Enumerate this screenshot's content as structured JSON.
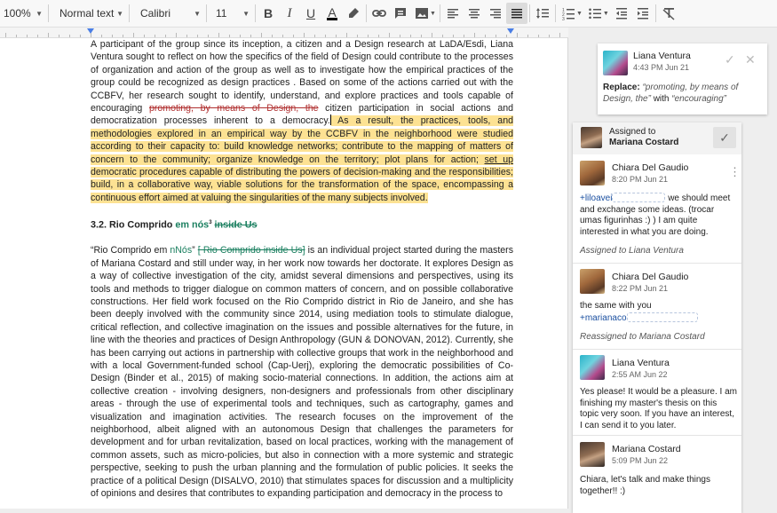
{
  "toolbar": {
    "zoom": "100%",
    "style": "Normal text",
    "font": "Calibri",
    "size": "11"
  },
  "document": {
    "para1_a": "A participant of the group since its inception, a citizen and a Design research at LaDA/Esdi, Liana Ventura sought to reflect on how the specifics of the field of Design could contribute to the processes of organization and action of the group as well as to investigate how the empirical practices of the group could be recognized as design practices . Based on some of the actions carried out with the CCBFV, her research sought to identify, understand, and explore practices and tools capable of encouraging ",
    "para1_strike": "promoting, by means of Design, the",
    "para1_b": " citizen participation in social actions and democratization processes inherent to a democracy.",
    "para1_hl_a": " As a result, the practices, tools, and methodologies explored in an empirical way by the CCBFV in the neighborhood were studied according to their capacity to: build knowledge networks; contribute to the mapping of matters of concern to the community; organize knowledge on the territory; plot plans for action; ",
    "para1_hl_u": "set up",
    "para1_hl_b": " democratic procedures capable of distributing the powers of decision-making and the responsibilities; build, in a collaborative way, viable solutions for the transformation of the space, encompassing a continuous effort aimed at valuing the singularities of the many subjects involved.",
    "heading_a": "3.2. Rio Comprido ",
    "heading_green": "em nós",
    "heading_sup": "3",
    "heading_strike": "inside Us",
    "para2_a": "“Rio Comprido em ",
    "para2_green": "nNós",
    "para2_q": "” ",
    "para2_strike": "[ Rio Comprido inside Us]",
    "para2_b": " is an individual project started during the masters of Mariana Costard and still under way, in her work now towards her doctorate. It explores Design as a way of collective investigation of the city, amidst several dimensions and perspectives, using its tools and methods to trigger dialogue on common matters of concern, and on possible collaborative constructions. Her field work focused on the Rio Comprido district in Rio de Janeiro, and she has been deeply involved with the community since 2014, using mediation tools to stimulate dialogue, critical reflection, and collective imagination on the issues and possible alternatives for the future, in line with the theories and practices of Design Anthropology (GUN & DONOVAN, 2012). Currently, she has been carrying out actions in partnership with collective groups that work in the neighborhood and with a local Government-funded school (Cap-Uerj), exploring the democratic possibilities of Co-Design (Binder et al., 2015) of making socio-material connections. In addition, the actions aim at collective creation - involving designers, non-designers and professionals from other disciplinary areas - through the use of experimental tools and techniques, such as cartography, games and visualization and imagination activities. The research focuses on the improvement of the neighborhood, albeit aligned with an autonomous Design that challenges the parameters for development and for urban revitalization, based on local practices, working with the management of common assets, such as micro-policies, but also in connection with a more systemic and strategic perspective, seeking to push the urban planning and the formulation of public policies. It seeks the practice of a political Design (DISALVO, 2010) that stimulates spaces for discussion and a multiplicity of opinions and desires that contributes to expanding participation and democracy in the process to"
  },
  "suggestion": {
    "author": "Liana Ventura",
    "time": "4:43 PM Jun 21",
    "replace_label": "Replace:",
    "from": "“promoting, by means of Design, the”",
    "with_word": "with",
    "to": "“encouraging”"
  },
  "thread": {
    "assigned_label": "Assigned to",
    "assignee": "Mariana Costard",
    "comments": [
      {
        "author": "Chiara Del Gaudio",
        "time": "8:20 PM Jun 21",
        "mention": "+liloavei",
        "text_a": " we should meet and exchange some ideas. (trocar umas figurinhas :) ) I am quite interested in what you are doing.",
        "note": "Assigned to Liana Ventura"
      },
      {
        "author": "Chiara Del Gaudio",
        "time": "8:22 PM Jun 21",
        "text_a": "the same with you",
        "mention": "+marianaco",
        "note": "Reassigned to Mariana Costard"
      },
      {
        "author": "Liana Ventura",
        "time": "2:55 AM Jun 22",
        "text_a": "Yes please! It would be a pleasure. I am finishing my master's thesis on this topic very soon. If you have an interest, I can send it to you later."
      },
      {
        "author": "Mariana Costard",
        "time": "5:09 PM Jun 22",
        "text_a": "Chiara, let's talk and make things together!! :)"
      }
    ]
  },
  "colors": {
    "highlight": "#fde293",
    "suggestion_strike": "#b03030",
    "suggestion_insert": "#1a7f5f",
    "mention": "#1a4fa0"
  }
}
